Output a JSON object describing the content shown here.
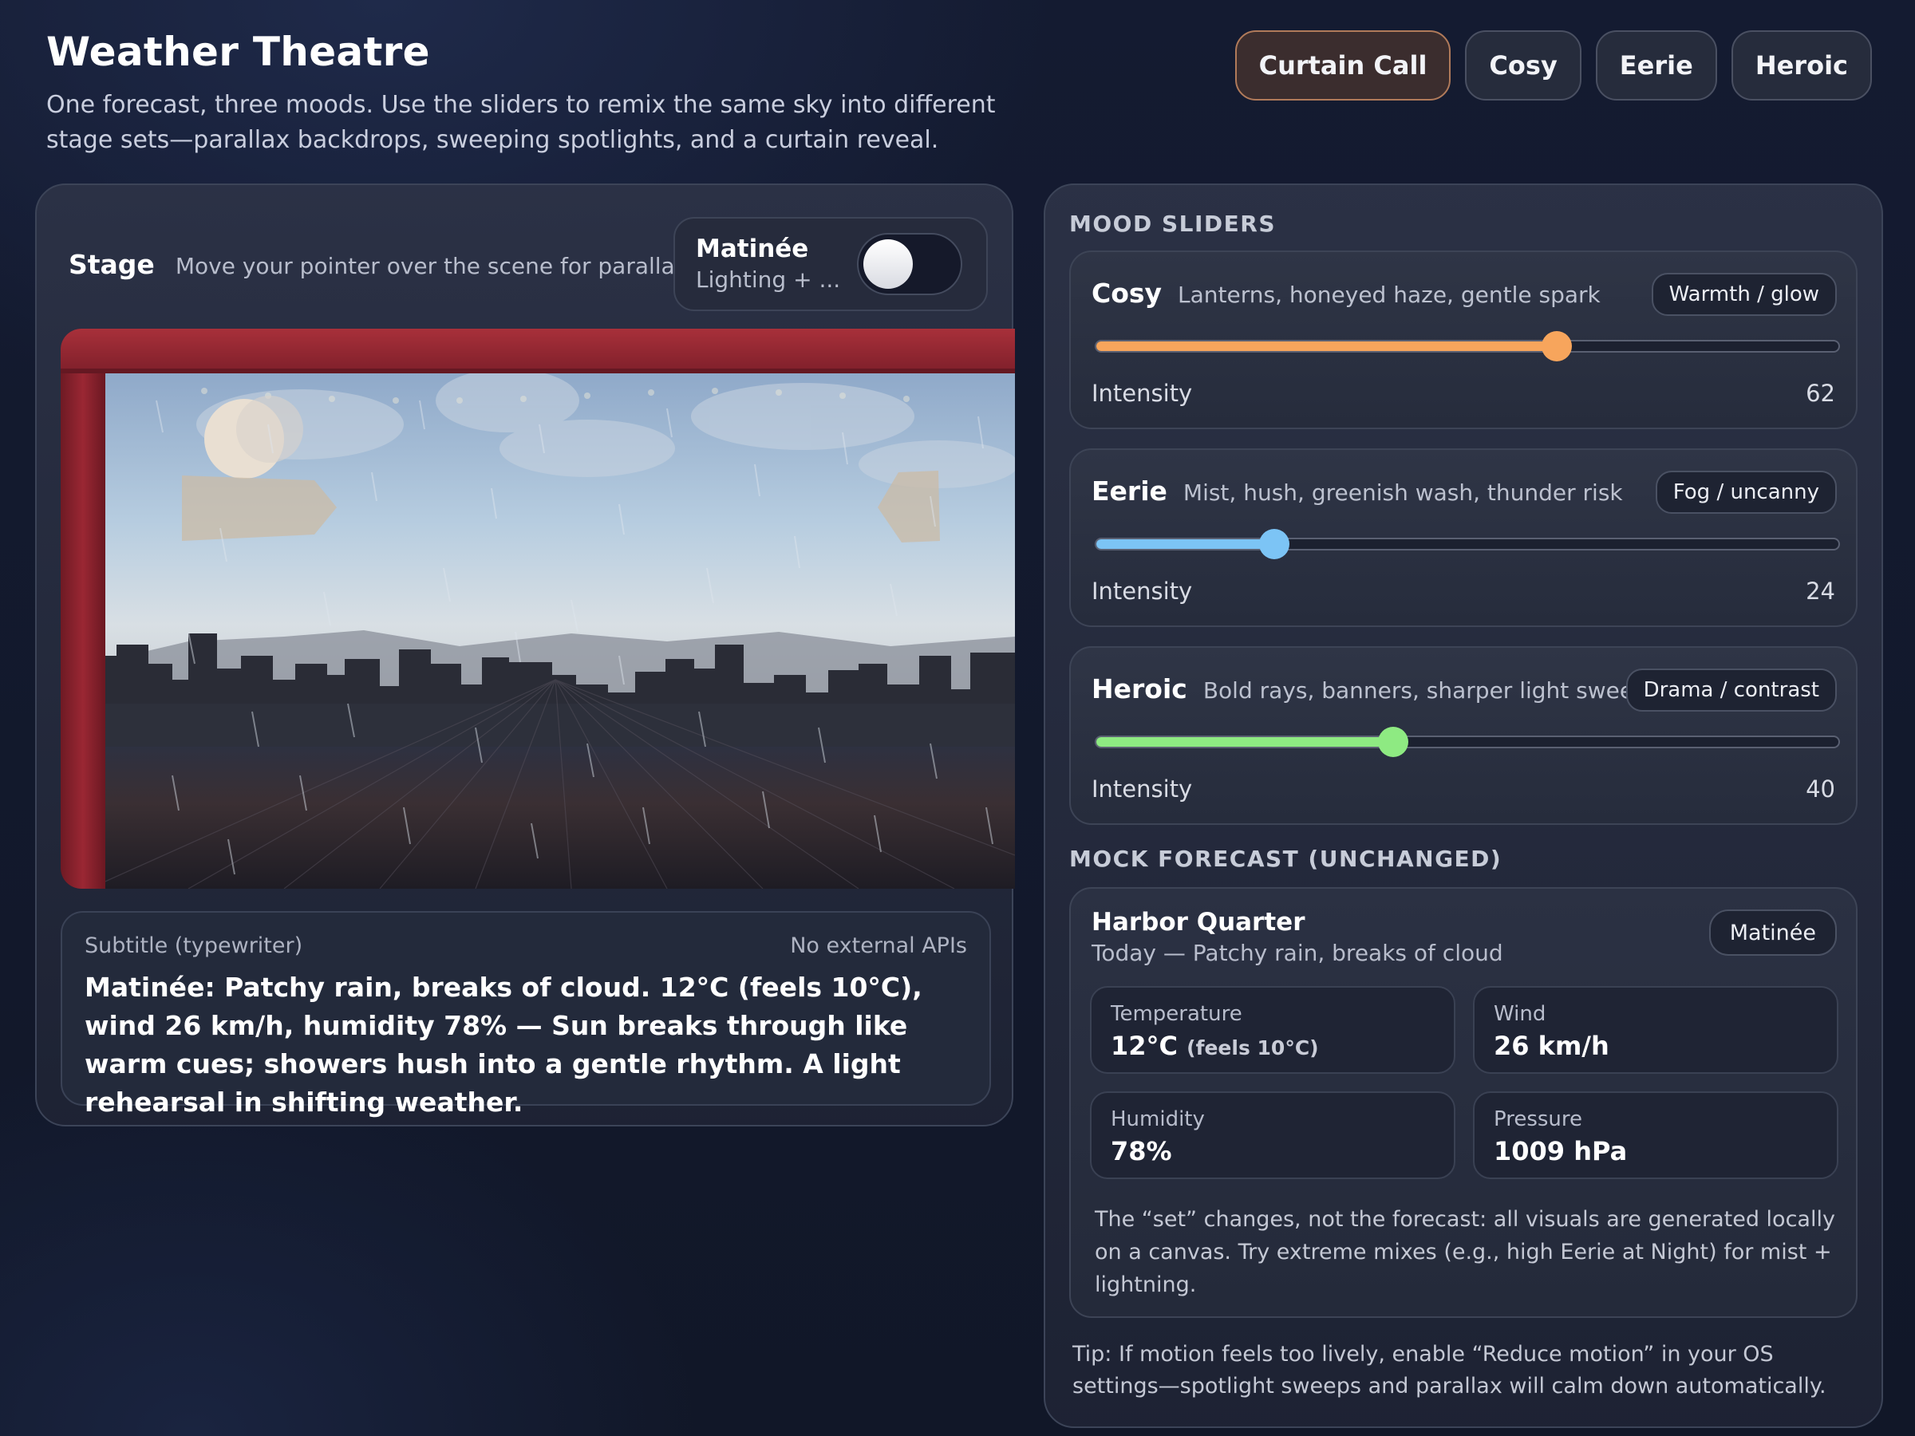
{
  "header": {
    "title": "Weather Theatre",
    "subtitle": "One forecast, three moods. Use the sliders to remix the same sky into different stage sets—parallax backdrops, sweeping spotlights, and a curtain reveal."
  },
  "mood_buttons": [
    {
      "label": "Curtain Call",
      "active": true
    },
    {
      "label": "Cosy",
      "active": false
    },
    {
      "label": "Eerie",
      "active": false
    },
    {
      "label": "Heroic",
      "active": false
    }
  ],
  "stage": {
    "label": "Stage",
    "hint": "Move your pointer over the scene for paralla...",
    "toggle": {
      "title": "Matinée",
      "subtitle": "Lighting + ...",
      "on": false
    }
  },
  "caption": {
    "label": "Subtitle (typewriter)",
    "note": "No external APIs",
    "text": "Matinée: Patchy rain, breaks of cloud. 12°C (feels 10°C), wind 26 km/h, humidity 78% — Sun breaks through like warm cues; showers hush into a gentle rhythm. A light rehearsal in shifting weather."
  },
  "sliders": {
    "section_title": "MOOD SLIDERS",
    "items": [
      {
        "name": "Cosy",
        "desc": "Lanterns, honeyed haze, gentle spark",
        "chip": "Warmth / glow",
        "label": "Intensity",
        "value": 62,
        "color": "#f7a55c"
      },
      {
        "name": "Eerie",
        "desc": "Mist, hush, greenish wash, thunder risk",
        "chip": "Fog / uncanny",
        "label": "Intensity",
        "value": 24,
        "color": "#7cc4f5"
      },
      {
        "name": "Heroic",
        "desc": "Bold rays, banners, sharper light sweeps",
        "chip": "Drama / contrast",
        "label": "Intensity",
        "value": 40,
        "color": "#8eea82"
      }
    ]
  },
  "forecast": {
    "section_title": "MOCK FORECAST (UNCHANGED)",
    "place": "Harbor Quarter",
    "condition": "Today — Patchy rain, breaks of cloud",
    "chip": "Matinée",
    "metrics": [
      {
        "label": "Temperature",
        "value": "12°C",
        "extra": "(feels 10°C)"
      },
      {
        "label": "Wind",
        "value": "26 km/h",
        "extra": ""
      },
      {
        "label": "Humidity",
        "value": "78%",
        "extra": ""
      },
      {
        "label": "Pressure",
        "value": "1009 hPa",
        "extra": ""
      }
    ],
    "note": "The “set” changes, not the forecast: all visuals are generated locally on a canvas. Try extreme mixes (e.g., high Eerie at Night) for mist + lightning."
  },
  "tip": "Tip: If motion feels too lively, enable “Reduce motion” in your OS settings—spotlight sweeps and parallax will calm down automatically."
}
